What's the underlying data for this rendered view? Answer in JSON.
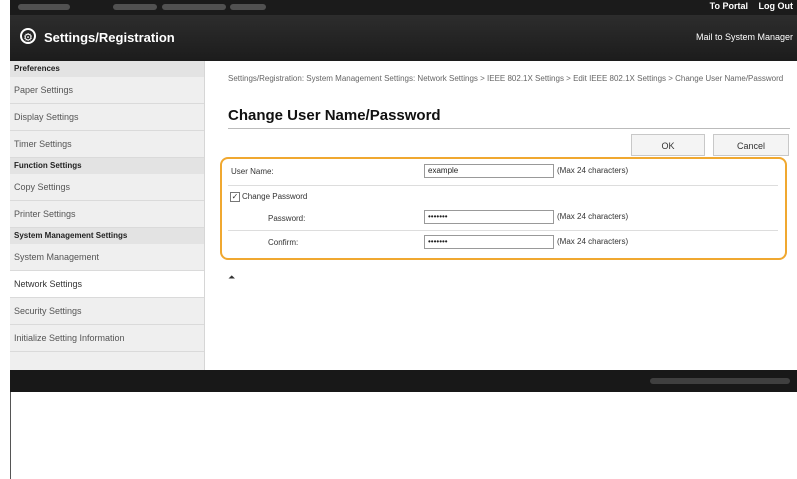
{
  "topbar": {
    "links": [
      "To Portal",
      "Log Out"
    ]
  },
  "header": {
    "title": "Settings/Registration",
    "mail_link": "Mail to System Manager",
    "logo_icon": "settings-gear-icon"
  },
  "sidebar": {
    "sections": [
      {
        "heading": "Preferences",
        "items": [
          "Paper Settings",
          "Display Settings",
          "Timer Settings"
        ]
      },
      {
        "heading": "Function Settings",
        "items": [
          "Copy Settings",
          "Printer Settings"
        ]
      },
      {
        "heading": "System Management Settings",
        "items": [
          "System Management",
          "Network Settings",
          "Security Settings",
          "Initialize Setting Information"
        ]
      }
    ],
    "selected": "Network Settings"
  },
  "main": {
    "breadcrumb": "Settings/Registration: System Management Settings: Network Settings > IEEE 802.1X Settings > Edit IEEE 802.1X Settings > Change User Name/Password",
    "title": "Change User Name/Password",
    "ok_label": "OK",
    "cancel_label": "Cancel",
    "form": {
      "user_name_label": "User Name:",
      "user_name_value": "example",
      "user_name_hint": "(Max 24 characters)",
      "change_password_label": "Change Password",
      "change_password_checked": true,
      "password_label": "Password:",
      "password_value": "•••••••",
      "password_hint": "(Max 24 characters)",
      "confirm_label": "Confirm:",
      "confirm_value": "•••••••",
      "confirm_hint": "(Max 24 characters)"
    },
    "top_icon": "back-to-top-icon"
  },
  "colors": {
    "highlight": "#f0a830",
    "header_bg": "#1c1c1c"
  }
}
